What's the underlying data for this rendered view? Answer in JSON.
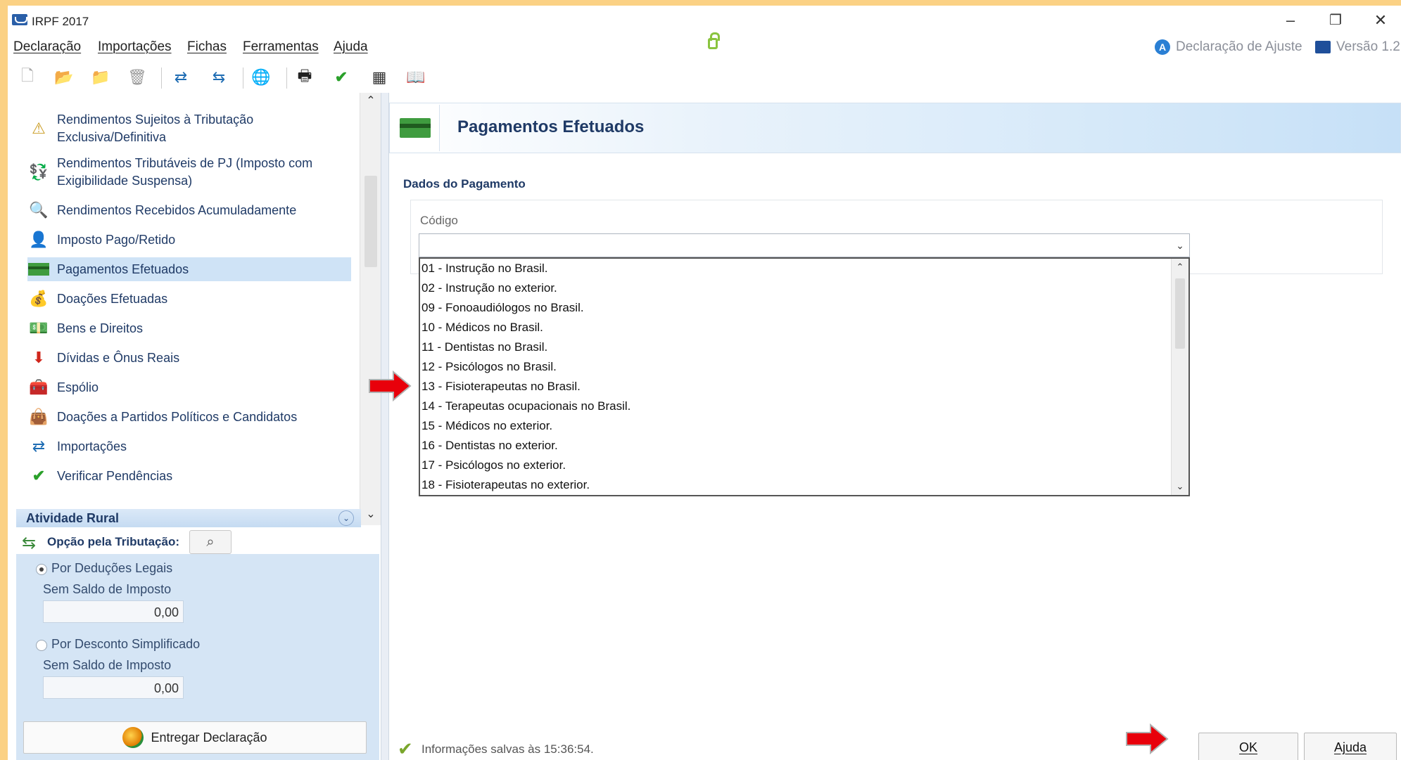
{
  "window": {
    "title": "IRPF 2017",
    "controls": {
      "minimize": "–",
      "restore": "❐",
      "close": "✕"
    }
  },
  "menu": {
    "items": [
      "Declaração",
      "Importações",
      "Fichas",
      "Ferramentas",
      "Ajuda"
    ]
  },
  "status": {
    "declaration_type": "Declaração de Ajuste",
    "version": "Versão 1.2",
    "declaration_icon_letter": "A"
  },
  "nav": {
    "items": [
      {
        "label": "Rendimentos Sujeitos à Tributação Exclusiva/Definitiva",
        "icon": "document-warning-icon"
      },
      {
        "label": "Rendimentos Tributáveis de PJ (Imposto com Exigibilidade Suspensa)",
        "icon": "money-people-icon"
      },
      {
        "label": "Rendimentos Recebidos Acumuladamente",
        "icon": "document-search-icon"
      },
      {
        "label": "Imposto Pago/Retido",
        "icon": "person-coin-icon"
      },
      {
        "label": "Pagamentos Efetuados",
        "icon": "credit-card-icon"
      },
      {
        "label": "Doações Efetuadas",
        "icon": "donation-icon"
      },
      {
        "label": "Bens e Direitos",
        "icon": "assets-icon"
      },
      {
        "label": "Dívidas e Ônus Reais",
        "icon": "debt-arrow-icon"
      },
      {
        "label": "Espólio",
        "icon": "chest-icon"
      },
      {
        "label": "Doações a Partidos Políticos e Candidatos",
        "icon": "political-donation-icon"
      },
      {
        "label": "Importações",
        "icon": "import-icon"
      },
      {
        "label": "Verificar Pendências",
        "icon": "checkmark-icon"
      }
    ],
    "selected_index": 4,
    "section_header": "Atividade Rural"
  },
  "tax_option": {
    "label": "Opção pela Tributação:",
    "deducoes": {
      "label": "Por Deduções Legais",
      "sub_label": "Sem Saldo de Imposto",
      "value": "0,00",
      "checked": true
    },
    "simplificado": {
      "label": "Por Desconto Simplificado",
      "sub_label": "Sem Saldo de Imposto",
      "value": "0,00",
      "checked": false
    },
    "submit_button": "Entregar Declaração"
  },
  "form": {
    "title": "Pagamentos Efetuados",
    "group_title": "Dados do Pagamento",
    "field_label": "Código",
    "field_value": "",
    "options": [
      "01 - Instrução no Brasil.",
      "02 - Instrução no exterior.",
      "09 - Fonoaudiólogos no Brasil.",
      "10 - Médicos no Brasil.",
      "11 - Dentistas no Brasil.",
      "12 - Psicólogos no Brasil.",
      "13 - Fisioterapeutas no Brasil.",
      "14 - Terapeutas ocupacionais no Brasil.",
      "15 - Médicos no exterior.",
      "16 - Dentistas no exterior.",
      "17 - Psicólogos no exterior.",
      "18 - Fisioterapeutas no exterior."
    ]
  },
  "footer": {
    "saved_info": "Informações salvas às 15:36:54.",
    "ok_button": "OK",
    "help_button": "Ajuda"
  },
  "colors": {
    "accent": "#1f3a66",
    "selection": "#cfe3f6",
    "arrow": "#e8000b",
    "background_frame": "#fbd184"
  }
}
